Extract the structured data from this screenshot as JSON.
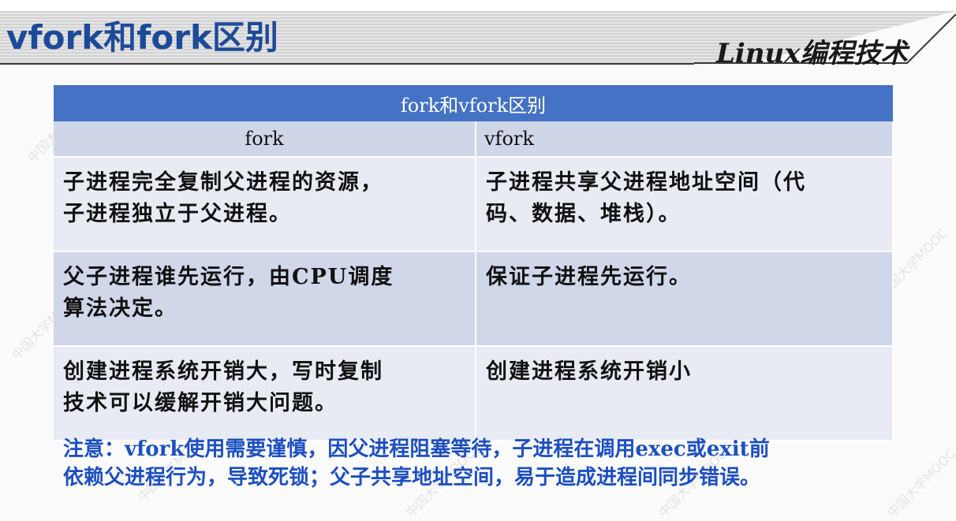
{
  "header": {
    "title": "vfork和fork区别",
    "subtitle": "Linux编程技术"
  },
  "table": {
    "caption": "fork和vfork区别",
    "columns": [
      "fork",
      "vfork"
    ],
    "rows": [
      {
        "fork": [
          "子进程完全复制父进程的资源，",
          "子进程独立于父进程。"
        ],
        "vfork": [
          "子进程共享父进程地址空间（代",
          "码、数据、堆栈）。"
        ]
      },
      {
        "fork": [
          "父子进程谁先运行，由CPU调度",
          "算法决定。"
        ],
        "vfork": [
          "保证子进程先运行。"
        ]
      },
      {
        "fork": [
          "创建进程系统开销大，写时复制",
          "技术可以缓解开销大问题。"
        ],
        "vfork": [
          "创建进程系统开销小"
        ]
      }
    ]
  },
  "note": {
    "line1": "注意：vfork使用需要谨慎，因父进程阻塞等待，子进程在调用exec或exit前",
    "line2": "依赖父进程行为，导致死锁；父子共享地址空间，易于造成进程间同步错误。"
  },
  "watermark": "中国大学MOOC",
  "colors": {
    "title_blue": "#1d4a98",
    "table_header": "#4472c4",
    "row_light": "#e8ebf4",
    "row_dark": "#d0d7e9",
    "note_blue": "#1d4fc0"
  }
}
